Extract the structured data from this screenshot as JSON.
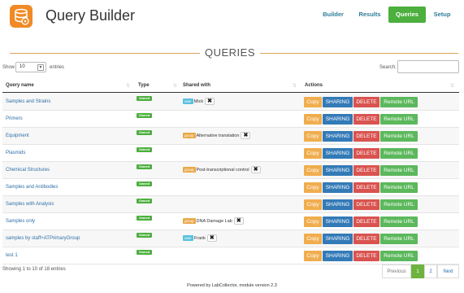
{
  "header": {
    "app_title": "Query Builder",
    "logo_icon": "database-gear-icon",
    "nav": [
      {
        "label": "Builder",
        "active": false
      },
      {
        "label": "Results",
        "active": false
      },
      {
        "label": "Queries",
        "active": true
      },
      {
        "label": "Setup",
        "active": false
      }
    ]
  },
  "section_title": "QUERIES",
  "controls": {
    "show_label": "Show",
    "entries_value": "10",
    "entries_label": "entries",
    "search_label": "Search:",
    "search_value": ""
  },
  "table": {
    "columns": [
      "Query name",
      "Type",
      "Shared with",
      "Actions"
    ],
    "rows": [
      {
        "name": "Samples and Strains",
        "type": "Owned",
        "shared": {
          "kind": "user",
          "name": "Mick"
        }
      },
      {
        "name": "Primers",
        "type": "Owned",
        "shared": null
      },
      {
        "name": "Equipment",
        "type": "Owned",
        "shared": {
          "kind": "group",
          "name": "Alternative translation"
        }
      },
      {
        "name": "Plasmids",
        "type": "Owned",
        "shared": null
      },
      {
        "name": "Chemical Structures",
        "type": "Owned",
        "shared": {
          "kind": "group",
          "name": "Post-transcriptional control"
        }
      },
      {
        "name": "Samples and Antibodies",
        "type": "Owned",
        "shared": null
      },
      {
        "name": "Samples with Analysis",
        "type": "Owned",
        "shared": null
      },
      {
        "name": "Samples only",
        "type": "Owned",
        "shared": {
          "kind": "group",
          "name": "DNA Damage Lab"
        }
      },
      {
        "name": "samples by staff+ATPrimaryGroup",
        "type": "Owned",
        "shared": {
          "kind": "user",
          "name": "Frank"
        }
      },
      {
        "name": "test 1",
        "type": "Owned",
        "shared": null
      }
    ],
    "actions": {
      "copy": "Copy",
      "sharing": "SHARING",
      "delete": "DELETE",
      "remote": "Remote URL"
    },
    "remove_symbol": "✖"
  },
  "footer": {
    "info": "Showing 1 to 10 of 18 entries",
    "pagination": {
      "previous": "Previous",
      "pages": [
        "1",
        "2"
      ],
      "current": "1",
      "next": "Next"
    },
    "powered": "Powered by LabCollector, module version 2.3"
  },
  "colors": {
    "accent_green": "#4caf3e",
    "logo_orange": "#f08a24",
    "copy": "#f0ad4e",
    "sharing": "#337ab7",
    "delete": "#d9534f",
    "remote": "#5cb85c",
    "link": "#2e6fa8"
  }
}
